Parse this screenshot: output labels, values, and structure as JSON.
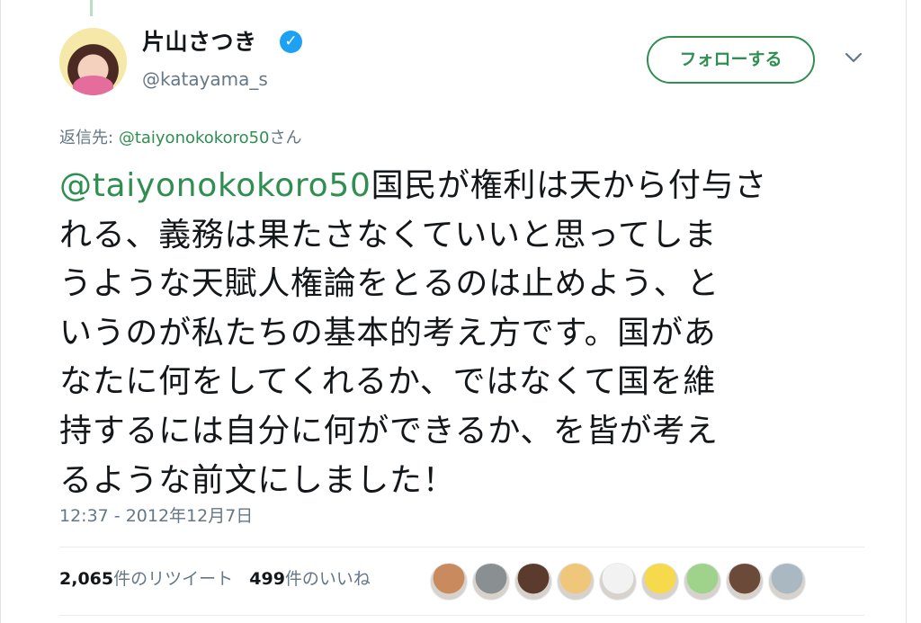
{
  "author": {
    "display_name": "片山さつき",
    "username": "@katayama_s",
    "verified_icon": "verified-badge-icon"
  },
  "follow_button": {
    "label": "フォローする"
  },
  "menu": {
    "icon": "chevron-down-icon"
  },
  "reply_to": {
    "label": "返信先:",
    "handle": "@taiyonokokoro50",
    "suffix": "さん"
  },
  "tweet": {
    "mention": "@taiyonokokoro50",
    "lines": [
      "国民が権利は天から付与さ",
      "れる、義務は果たさなくていいと思ってしま",
      "うような天賦人権論をとるのは止めよう、と",
      "いうのが私たちの基本的考え方です。国があ",
      "なたに何をしてくれるか、ではなくて国を維",
      "持するには自分に何ができるか、を皆が考え",
      "るような前文にしました！"
    ]
  },
  "timestamp": "12:37 - 2012年12月7日",
  "stats": {
    "retweets_count": "2,065",
    "retweets_label": "件のリツイート",
    "likes_count": "499",
    "likes_label": "件のいいね"
  },
  "likers": [
    {
      "icon": "liker-avatar-1",
      "color": "#c98b5e"
    },
    {
      "icon": "liker-avatar-2",
      "color": "#8a8f92"
    },
    {
      "icon": "liker-avatar-3",
      "color": "#5b3b2e"
    },
    {
      "icon": "liker-avatar-4",
      "color": "#f0c77a"
    },
    {
      "icon": "liker-avatar-5",
      "color": "#f2f2f2"
    },
    {
      "icon": "liker-avatar-6",
      "color": "#f7d94c"
    },
    {
      "icon": "liker-avatar-7",
      "color": "#9fd28a"
    },
    {
      "icon": "liker-avatar-8",
      "color": "#6b4a3a"
    },
    {
      "icon": "liker-avatar-9",
      "color": "#aab8c2"
    }
  ]
}
